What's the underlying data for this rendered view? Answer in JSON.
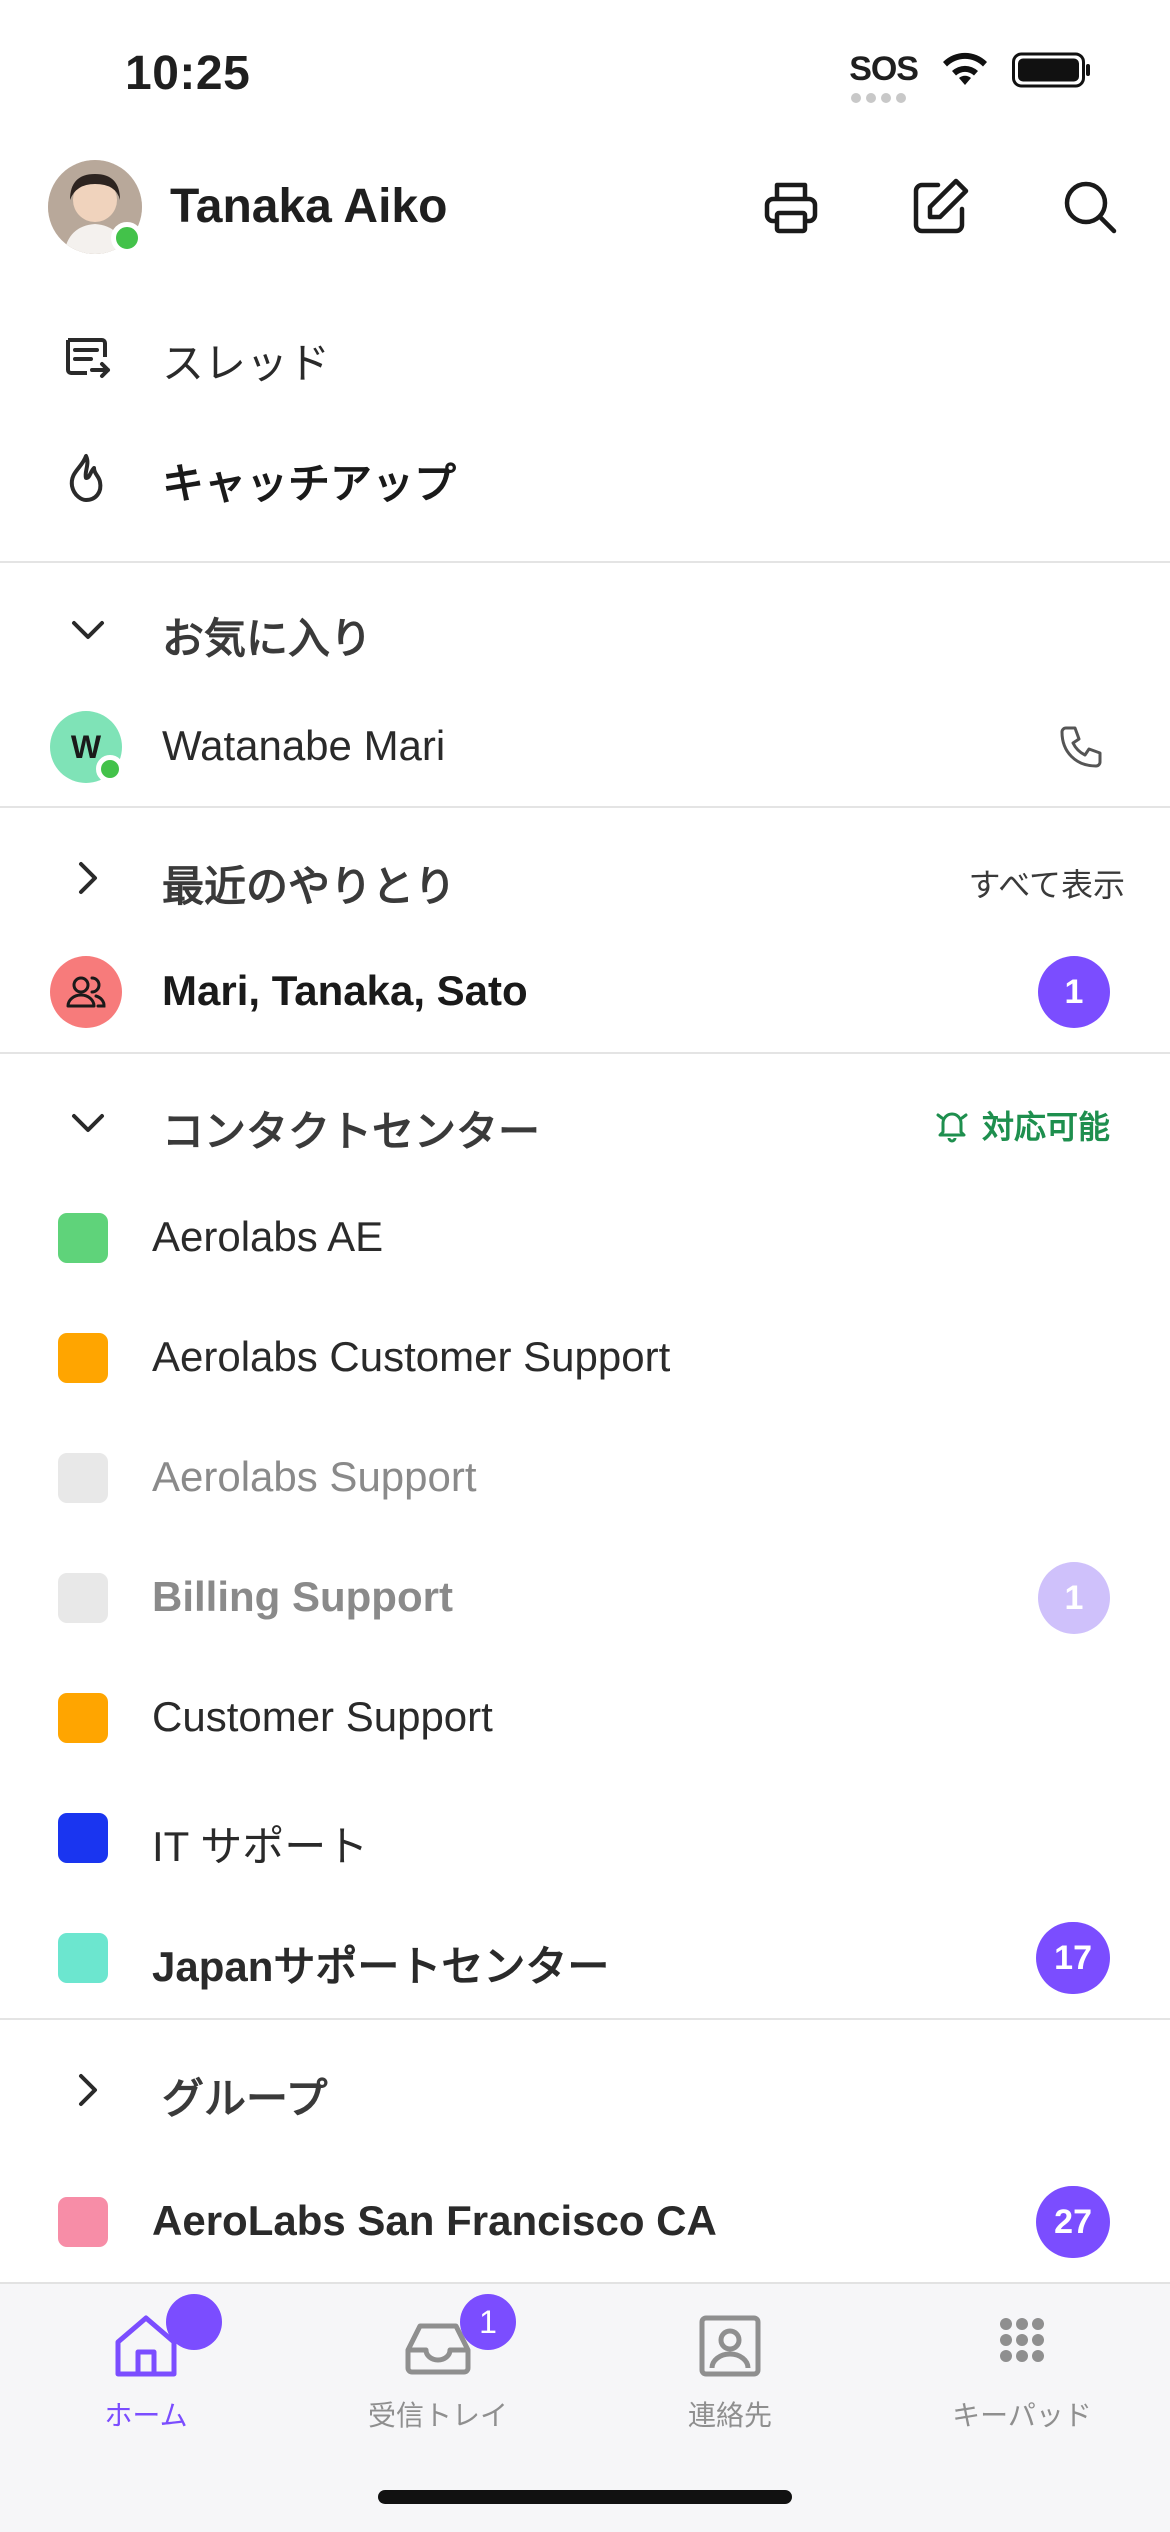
{
  "status_bar": {
    "time": "10:25",
    "sos": "SOS"
  },
  "header": {
    "user_name": "Tanaka Aiko"
  },
  "top_menu": [
    {
      "label": "スレッド",
      "icon": "threads-icon"
    },
    {
      "label": "キャッチアップ",
      "icon": "flame-icon"
    }
  ],
  "favorites": {
    "title": "お気に入り",
    "items": [
      {
        "initial": "W",
        "name": "Watanabe Mari"
      }
    ]
  },
  "recent": {
    "title": "最近のやりとり",
    "show_all": "すべて表示",
    "items": [
      {
        "name": "Mari, Tanaka, Sato",
        "badge": "1"
      }
    ]
  },
  "contact_center": {
    "title": "コンタクトセンター",
    "status": "対応可能",
    "status_color": "#1e8f4e",
    "items": [
      {
        "name": "Aerolabs AE",
        "color": "#5fd37a"
      },
      {
        "name": "Aerolabs Customer Support",
        "color": "#ffa500"
      },
      {
        "name": "Aerolabs Support",
        "color": "#e8e8e8"
      },
      {
        "name": "Billing Support",
        "color": "#e8e8e8",
        "badge": "1"
      },
      {
        "name": "Customer Support",
        "color": "#ffa500"
      },
      {
        "name": "IT サポート",
        "color": "#1a35f0"
      },
      {
        "name": "Japanサポートセンター",
        "color": "#6ce6cf",
        "badge": "17"
      }
    ]
  },
  "groups": {
    "title": "グループ",
    "items": [
      {
        "name": "AeroLabs San Francisco CA",
        "color": "#f78da7",
        "badge": "27"
      }
    ]
  },
  "tabbar": {
    "accent": "#7b4dff",
    "tabs": [
      {
        "label": "ホーム",
        "icon": "home-icon"
      },
      {
        "label": "受信トレイ",
        "icon": "inbox-icon",
        "badge": "1"
      },
      {
        "label": "連絡先",
        "icon": "contacts-icon"
      },
      {
        "label": "キーパッド",
        "icon": "keypad-icon"
      }
    ]
  }
}
